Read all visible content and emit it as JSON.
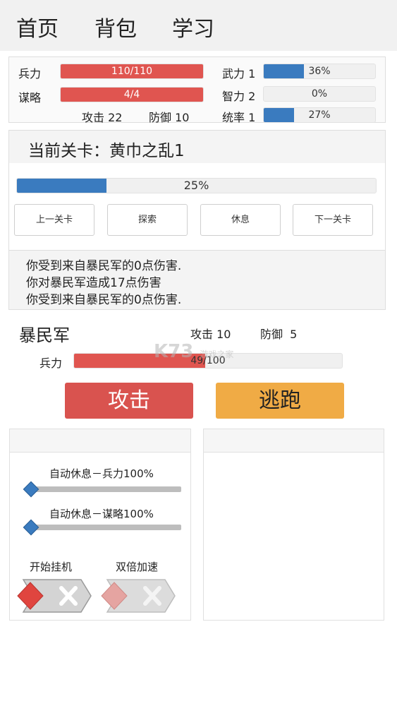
{
  "nav": {
    "items": [
      "首页",
      "背包",
      "学习"
    ]
  },
  "stats": {
    "troops": {
      "label": "兵力",
      "value_text": "110/110",
      "fraction": 1.0
    },
    "strategy": {
      "label": "谋略",
      "value_text": "4/4",
      "fraction": 1.0
    },
    "attack": "攻击 22",
    "defense": "防御 10",
    "might": {
      "label": "武力 1",
      "value_text": "36%",
      "fraction": 0.36
    },
    "intellect": {
      "label": "智力 2",
      "value_text": "0%",
      "fraction": 0.0
    },
    "command": {
      "label": "统率 1",
      "value_text": "27%",
      "fraction": 0.27
    }
  },
  "stage": {
    "title": "当前关卡：黄巾之乱1",
    "progress_text": "25%",
    "progress_fraction": 0.25,
    "buttons": {
      "prev": "上一关卡",
      "explore": "探索",
      "rest": "休息",
      "next": "下一关卡"
    },
    "log": [
      "你受到来自暴民军的0点伤害.",
      "你对暴民军造成17点伤害",
      "你受到来自暴民军的0点伤害."
    ]
  },
  "enemy": {
    "name": "暴民军",
    "attack": "攻击 10",
    "defense": "防御  5",
    "troops_label": "兵力",
    "troops_text": "49/100",
    "troops_fraction": 0.49
  },
  "actions": {
    "attack": "攻击",
    "flee": "逃跑"
  },
  "settings": {
    "auto_rest_troops": {
      "label": "自动休息－兵力100%",
      "fraction": 0.0
    },
    "auto_rest_strategy": {
      "label": "自动休息－谋略100%",
      "fraction": 0.0
    },
    "auto_idle": {
      "label": "开始挂机",
      "on": false
    },
    "double_speed": {
      "label": "双倍加速",
      "on": false
    }
  },
  "watermark": {
    "text": "K73",
    "sub": "游戏之家"
  },
  "colors": {
    "red": "#e05550",
    "blue": "#3a7bbf",
    "orange": "#f0ab45",
    "attack_button": "#d9534f"
  }
}
